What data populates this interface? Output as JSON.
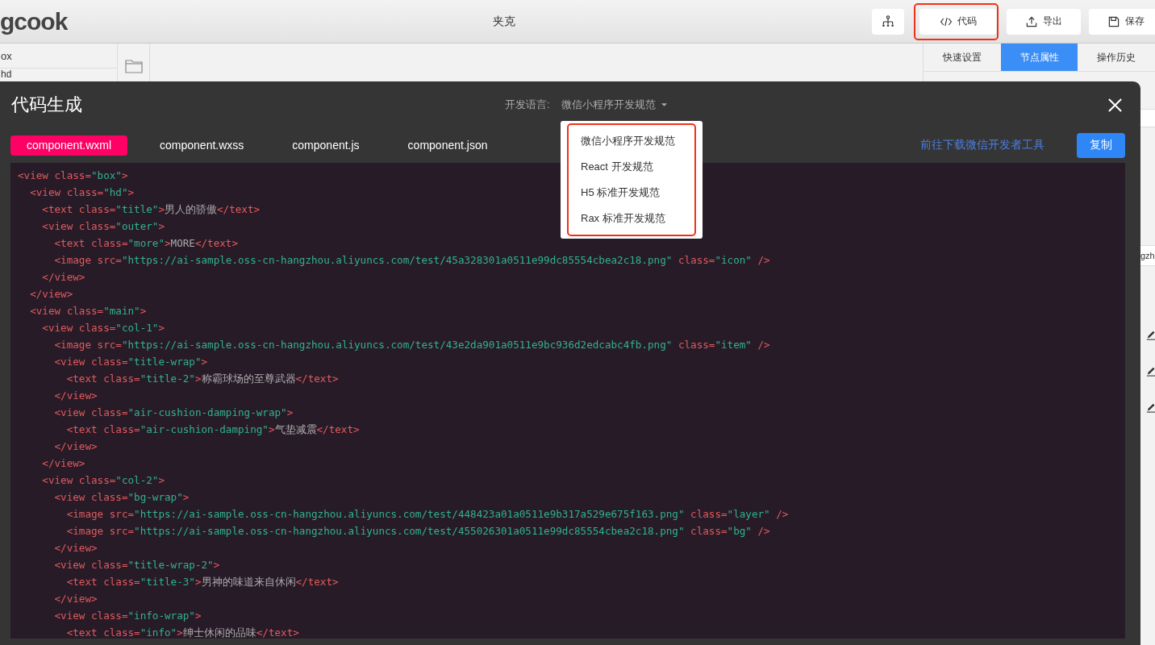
{
  "app_header": {
    "logo": "gcook",
    "title": "夹克",
    "actions": [
      {
        "kind": "icon",
        "highlighted": false
      },
      {
        "kind": "labelled",
        "label": "代码",
        "highlighted": true
      },
      {
        "kind": "labelled",
        "label": "导出",
        "highlighted": false
      },
      {
        "kind": "labelled",
        "label": "保存",
        "highlighted": false
      }
    ]
  },
  "layer_panel": {
    "items": [
      "ox",
      "hd"
    ]
  },
  "right_panel": {
    "tabs": [
      {
        "label": "快速设置",
        "selected": false
      },
      {
        "label": "节点属性",
        "selected": true
      },
      {
        "label": "操作历史",
        "selected": false
      }
    ],
    "field_value": "gzh"
  },
  "modal": {
    "title": "代码生成",
    "language_label": "开发语言:",
    "language_value": "微信小程序开发规范",
    "language_menu": {
      "highlighted": true,
      "items": [
        "微信小程序开发规范",
        "React 开发规范",
        "H5 标准开发规范",
        "Rax 标准开发规范"
      ]
    },
    "tabs": [
      {
        "label": "component.wxml",
        "selected": true
      },
      {
        "label": "component.wxss",
        "selected": false
      },
      {
        "label": "component.js",
        "selected": false
      },
      {
        "label": "component.json",
        "selected": false
      }
    ],
    "link": "前往下载微信开发者工具",
    "copy_button": "复制",
    "code_lines": [
      "<view class=\"box\">",
      "  <view class=\"hd\">",
      "    <text class=\"title\">男人的骄傲</text>",
      "    <view class=\"outer\">",
      "      <text class=\"more\">MORE</text>",
      "      <image src=\"https://ai-sample.oss-cn-hangzhou.aliyuncs.com/test/45a328301a0511e99dc85554cbea2c18.png\" class=\"icon\" />",
      "    </view>",
      "  </view>",
      "  <view class=\"main\">",
      "    <view class=\"col-1\">",
      "      <image src=\"https://ai-sample.oss-cn-hangzhou.aliyuncs.com/test/43e2da901a0511e9bc936d2edcabc4fb.png\" class=\"item\" />",
      "      <view class=\"title-wrap\">",
      "        <text class=\"title-2\">称霸球场的至尊武器</text>",
      "      </view>",
      "      <view class=\"air-cushion-damping-wrap\">",
      "        <text class=\"air-cushion-damping\">气垫减震</text>",
      "      </view>",
      "    </view>",
      "    <view class=\"col-2\">",
      "      <view class=\"bg-wrap\">",
      "        <image src=\"https://ai-sample.oss-cn-hangzhou.aliyuncs.com/test/448423a01a0511e9b317a529e675f163.png\" class=\"layer\" />",
      "        <image src=\"https://ai-sample.oss-cn-hangzhou.aliyuncs.com/test/455026301a0511e99dc85554cbea2c18.png\" class=\"bg\" />",
      "      </view>",
      "      <view class=\"title-wrap-2\">",
      "        <text class=\"title-3\">男神的味道来自休闲</text>",
      "      </view>",
      "      <view class=\"info-wrap\">",
      "        <text class=\"info\">绅士休闲的品味</text>"
    ]
  }
}
